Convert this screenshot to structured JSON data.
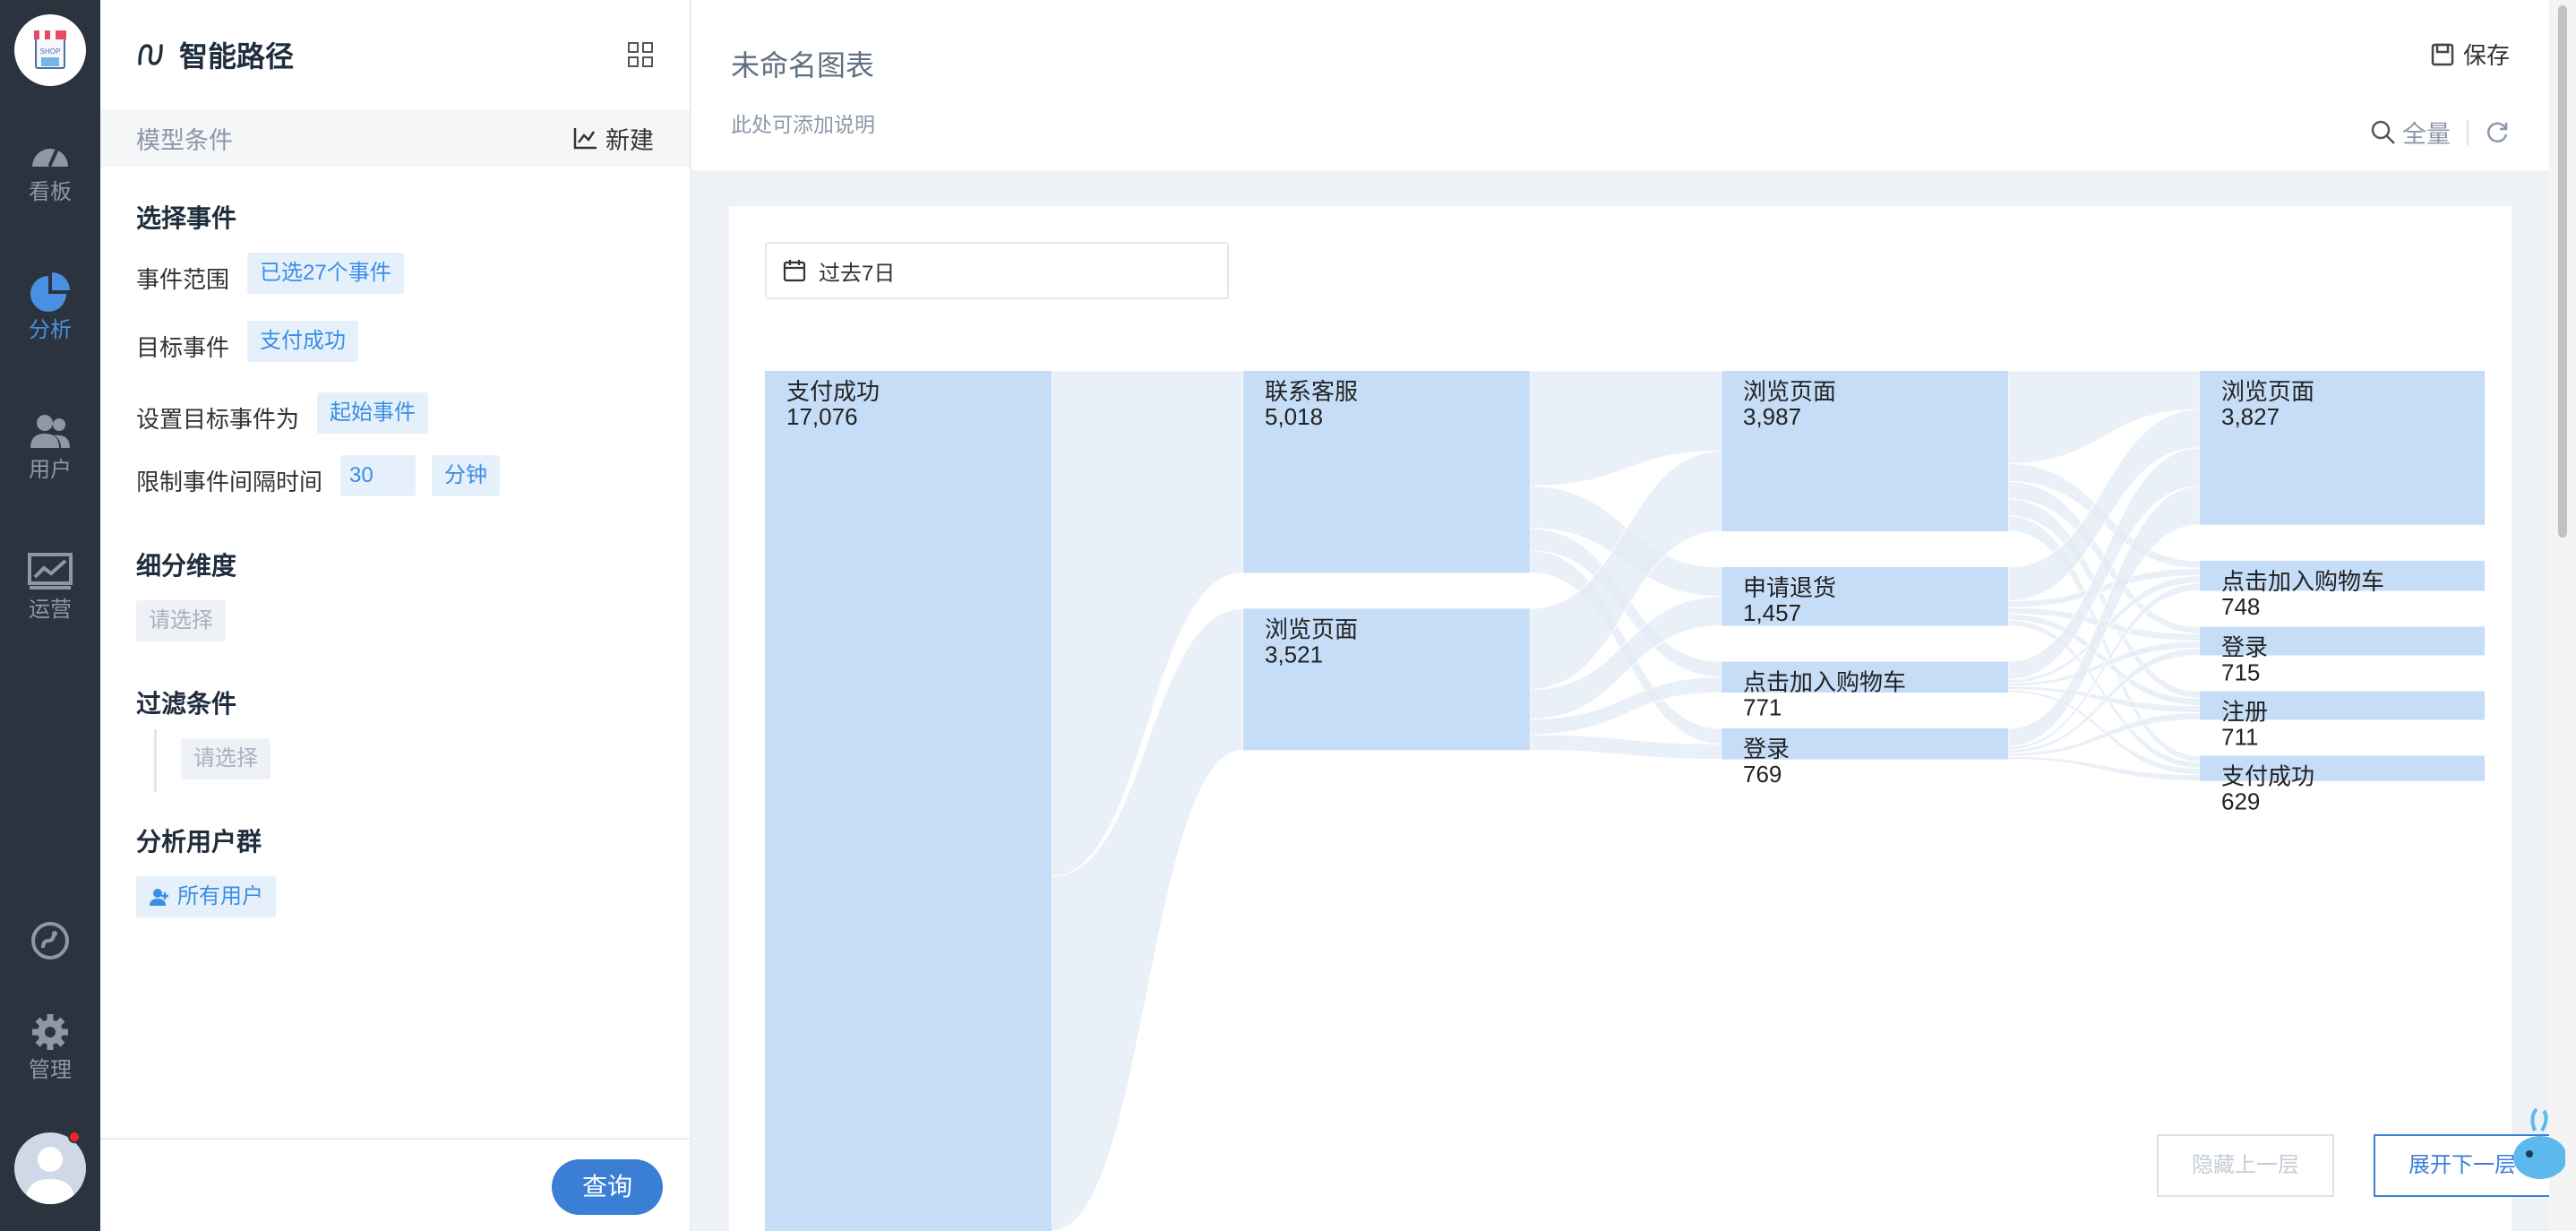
{
  "nav": {
    "logo_text": "SHOP",
    "items": [
      {
        "label": "看板",
        "icon": "dashboard-icon"
      },
      {
        "label": "分析",
        "icon": "pie-chart-icon",
        "active": true
      },
      {
        "label": "用户",
        "icon": "users-icon"
      },
      {
        "label": "运营",
        "icon": "operation-chart-icon"
      },
      {
        "label": "",
        "icon": "link-circle-icon"
      },
      {
        "label": "管理",
        "icon": "gear-icon"
      }
    ],
    "accent": "#4a90e2"
  },
  "panel": {
    "title": "智能路径",
    "subheader": {
      "label": "模型条件",
      "new_label": "新建"
    },
    "select_event": {
      "title": "选择事件",
      "scope_label": "事件范围",
      "scope_value": "已选27个事件",
      "target_label": "目标事件",
      "target_value": "支付成功",
      "set_target_label": "设置目标事件为",
      "set_target_value": "起始事件",
      "interval_label": "限制事件间隔时间",
      "interval_value": "30",
      "interval_unit": "分钟"
    },
    "dimension": {
      "title": "细分维度",
      "placeholder": "请选择"
    },
    "filter": {
      "title": "过滤条件",
      "placeholder": "请选择"
    },
    "user_group": {
      "title": "分析用户群",
      "value": "所有用户"
    },
    "query_label": "查询"
  },
  "main": {
    "title": "未命名图表",
    "description": "此处可添加说明",
    "save_label": "保存",
    "scope_label": "全量",
    "date_range": "过去7日",
    "hide_button": "隐藏上一层",
    "expand_button": "展开下一层"
  },
  "chart_data": {
    "type": "sankey",
    "columns": [
      {
        "nodes": [
          {
            "label": "支付成功",
            "value": 17076
          }
        ]
      },
      {
        "nodes": [
          {
            "label": "联系客服",
            "value": 5018
          },
          {
            "label": "浏览页面",
            "value": 3521
          }
        ]
      },
      {
        "nodes": [
          {
            "label": "浏览页面",
            "value": 3987
          },
          {
            "label": "申请退货",
            "value": 1457
          },
          {
            "label": "点击加入购物车",
            "value": 771
          },
          {
            "label": "登录",
            "value": 769
          }
        ]
      },
      {
        "nodes": [
          {
            "label": "浏览页面",
            "value": 3827
          },
          {
            "label": "点击加入购物车",
            "value": 748
          },
          {
            "label": "登录",
            "value": 715
          },
          {
            "label": "注册",
            "value": 711
          },
          {
            "label": "支付成功",
            "value": 629
          }
        ]
      }
    ],
    "node_color": "#c6ddf7",
    "link_color": "#e3ebf6"
  }
}
